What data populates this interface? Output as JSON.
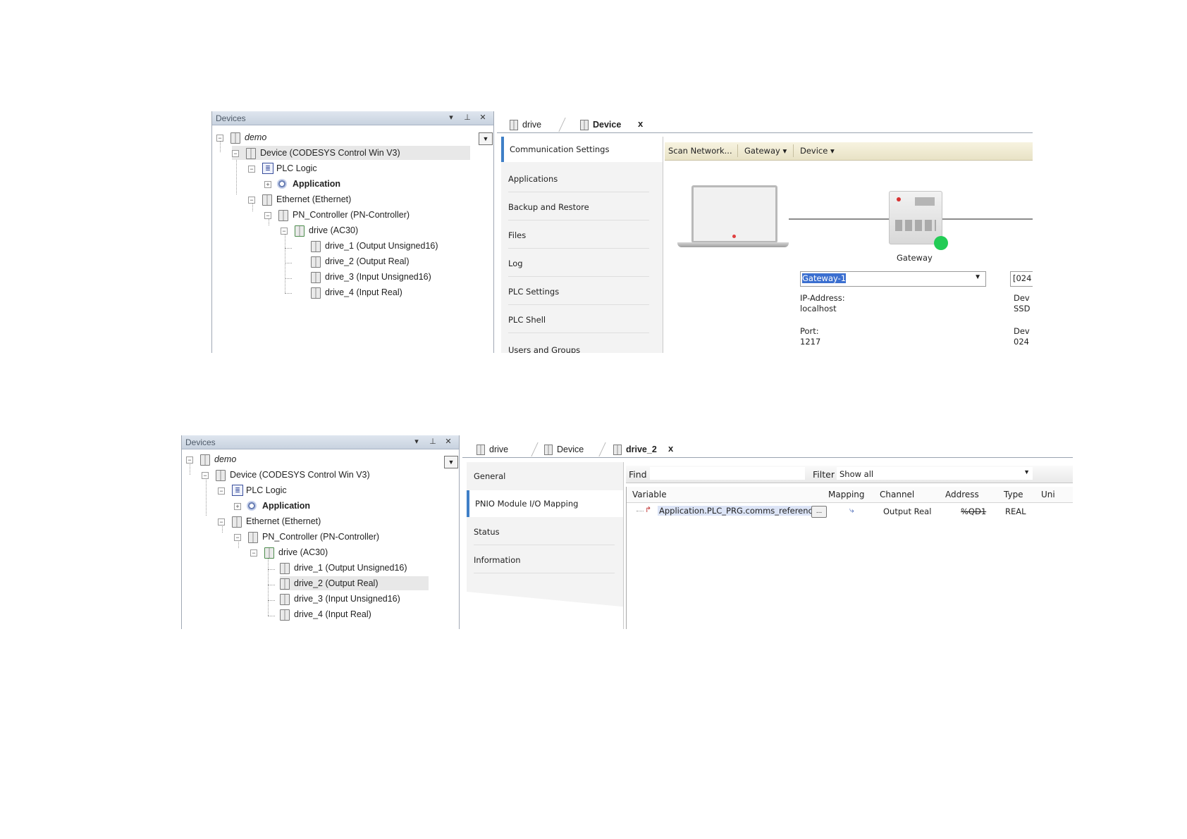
{
  "top": {
    "devices_panel": {
      "title": "Devices",
      "tree": [
        {
          "label": "demo"
        },
        {
          "label": "Device (CODESYS Control Win V3)"
        },
        {
          "label": "PLC Logic"
        },
        {
          "label": "Application"
        },
        {
          "label": "Ethernet (Ethernet)"
        },
        {
          "label": "PN_Controller (PN-Controller)"
        },
        {
          "label": "drive (AC30)"
        },
        {
          "label": "drive_1 (Output Unsigned16)"
        },
        {
          "label": "drive_2 (Output Real)"
        },
        {
          "label": "drive_3 (Input Unsigned16)"
        },
        {
          "label": "drive_4 (Input Real)"
        }
      ]
    },
    "tabs": [
      {
        "label": "drive"
      },
      {
        "label": "Device"
      }
    ],
    "close_glyph": "x",
    "menu": [
      "Communication Settings",
      "Applications",
      "Backup and Restore",
      "Files",
      "Log",
      "PLC Settings",
      "PLC Shell",
      "Users and Groups"
    ],
    "toolbar": {
      "scan": "Scan Network...",
      "gateway": "Gateway",
      "device": "Device"
    },
    "gateway": {
      "label": "Gateway",
      "select_value": "Gateway-1",
      "ip_label": "IP-Address:",
      "ip_value": "localhost",
      "port_label": "Port:",
      "port_value": "1217"
    },
    "device_cut": {
      "select_value": "[024",
      "l1": "Dev",
      "l2": "SSD",
      "l3": "Dev",
      "l4": "024"
    }
  },
  "bottom": {
    "devices_panel": {
      "title": "Devices",
      "tree": [
        {
          "label": "demo"
        },
        {
          "label": "Device (CODESYS Control Win V3)"
        },
        {
          "label": "PLC Logic"
        },
        {
          "label": "Application"
        },
        {
          "label": "Ethernet (Ethernet)"
        },
        {
          "label": "PN_Controller (PN-Controller)"
        },
        {
          "label": "drive (AC30)"
        },
        {
          "label": "drive_1 (Output Unsigned16)"
        },
        {
          "label": "drive_2 (Output Real)"
        },
        {
          "label": "drive_3 (Input Unsigned16)"
        },
        {
          "label": "drive_4 (Input Real)"
        }
      ]
    },
    "tabs": [
      {
        "label": "drive"
      },
      {
        "label": "Device"
      },
      {
        "label": "drive_2"
      }
    ],
    "close_glyph": "x",
    "menu": [
      "General",
      "PNIO Module I/O Mapping",
      "Status",
      "Information"
    ],
    "find_label": "Find",
    "filter_label": "Filter",
    "filter_value": "Show all",
    "columns": [
      "Variable",
      "Mapping",
      "Channel",
      "Address",
      "Type",
      "Uni"
    ],
    "row": {
      "variable": "Application.PLC_PRG.comms_reference",
      "ellipsis": "...",
      "channel": "Output Real",
      "address": "%QD1",
      "type": "REAL"
    }
  }
}
